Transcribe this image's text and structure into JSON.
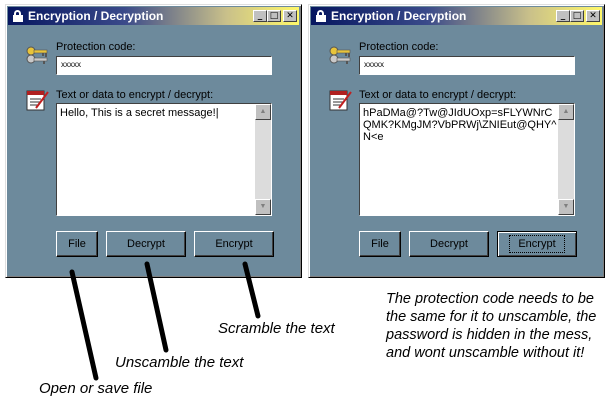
{
  "windows": [
    {
      "title": "Encryption / Decryption",
      "protection_code_label": "Protection code:",
      "password_value": "xxxxx",
      "text_label": "Text or data to encrypt / decrypt:",
      "text_value": "Hello, This is a secret message!|",
      "buttons": {
        "file": "File",
        "decrypt": "Decrypt",
        "encrypt": "Encrypt"
      }
    },
    {
      "title": "Encryption / Decryption",
      "protection_code_label": "Protection code:",
      "password_value": "xxxxx",
      "text_label": "Text or data to encrypt / decrypt:",
      "text_value": "hPaDMa@?Tw@JIdUOxp=sFLYWNrCQMK?KMgJM?VbPRWj\\ZNIEut@QHY^N<e",
      "buttons": {
        "file": "File",
        "decrypt": "Decrypt",
        "encrypt": "Encrypt"
      }
    }
  ],
  "title_buttons": {
    "minimize": "_",
    "maximize": "□",
    "close": "✕"
  },
  "scroll_arrows": {
    "up": "▲",
    "down": "▼"
  },
  "icons": {
    "title": "lock-icon",
    "protection": "keys-icon",
    "text": "notepad-icon"
  },
  "annotations": {
    "scramble": "Scramble the text",
    "unscramble": "Unscamble the text",
    "open_save": "Open or save file",
    "protection_note": "The protection code needs to be the same for it to unscamble, the password is hidden in the mess, and wont unscamble without it!"
  },
  "colors": {
    "window_bg": "#6d8a9c",
    "titlebar_start": "#06165f",
    "titlebar_end": "#fff86a"
  }
}
